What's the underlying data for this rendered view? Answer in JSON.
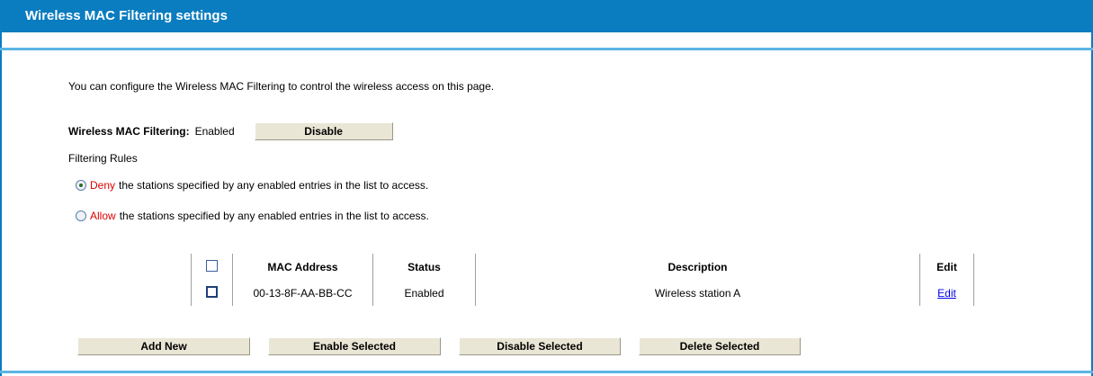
{
  "header": {
    "title": "Wireless MAC Filtering settings"
  },
  "intro": "You can configure the Wireless MAC Filtering to control the wireless access on this page.",
  "filtering": {
    "label": "Wireless MAC Filtering:",
    "state": "Enabled",
    "toggle_label": "Disable"
  },
  "rules": {
    "label": "Filtering Rules",
    "deny": {
      "keyword": "Deny",
      "text": "the stations specified by any enabled entries in the list to access.",
      "checked": true
    },
    "allow": {
      "keyword": "Allow",
      "text": "the stations specified by any enabled entries in the list to access.",
      "checked": false
    }
  },
  "table": {
    "headers": {
      "mac": "MAC Address",
      "status": "Status",
      "description": "Description",
      "edit": "Edit"
    },
    "rows": [
      {
        "mac": "00-13-8F-AA-BB-CC",
        "status": "Enabled",
        "description": "Wireless station A",
        "edit": "Edit"
      }
    ]
  },
  "actions": {
    "add": "Add New",
    "enable": "Enable Selected",
    "disable": "Disable Selected",
    "delete": "Delete Selected"
  },
  "colors": {
    "header_bg": "#0a7cc0",
    "accent_line": "#5bb4e5",
    "keyword": "#e00000",
    "button_bg": "#eae6d5"
  }
}
